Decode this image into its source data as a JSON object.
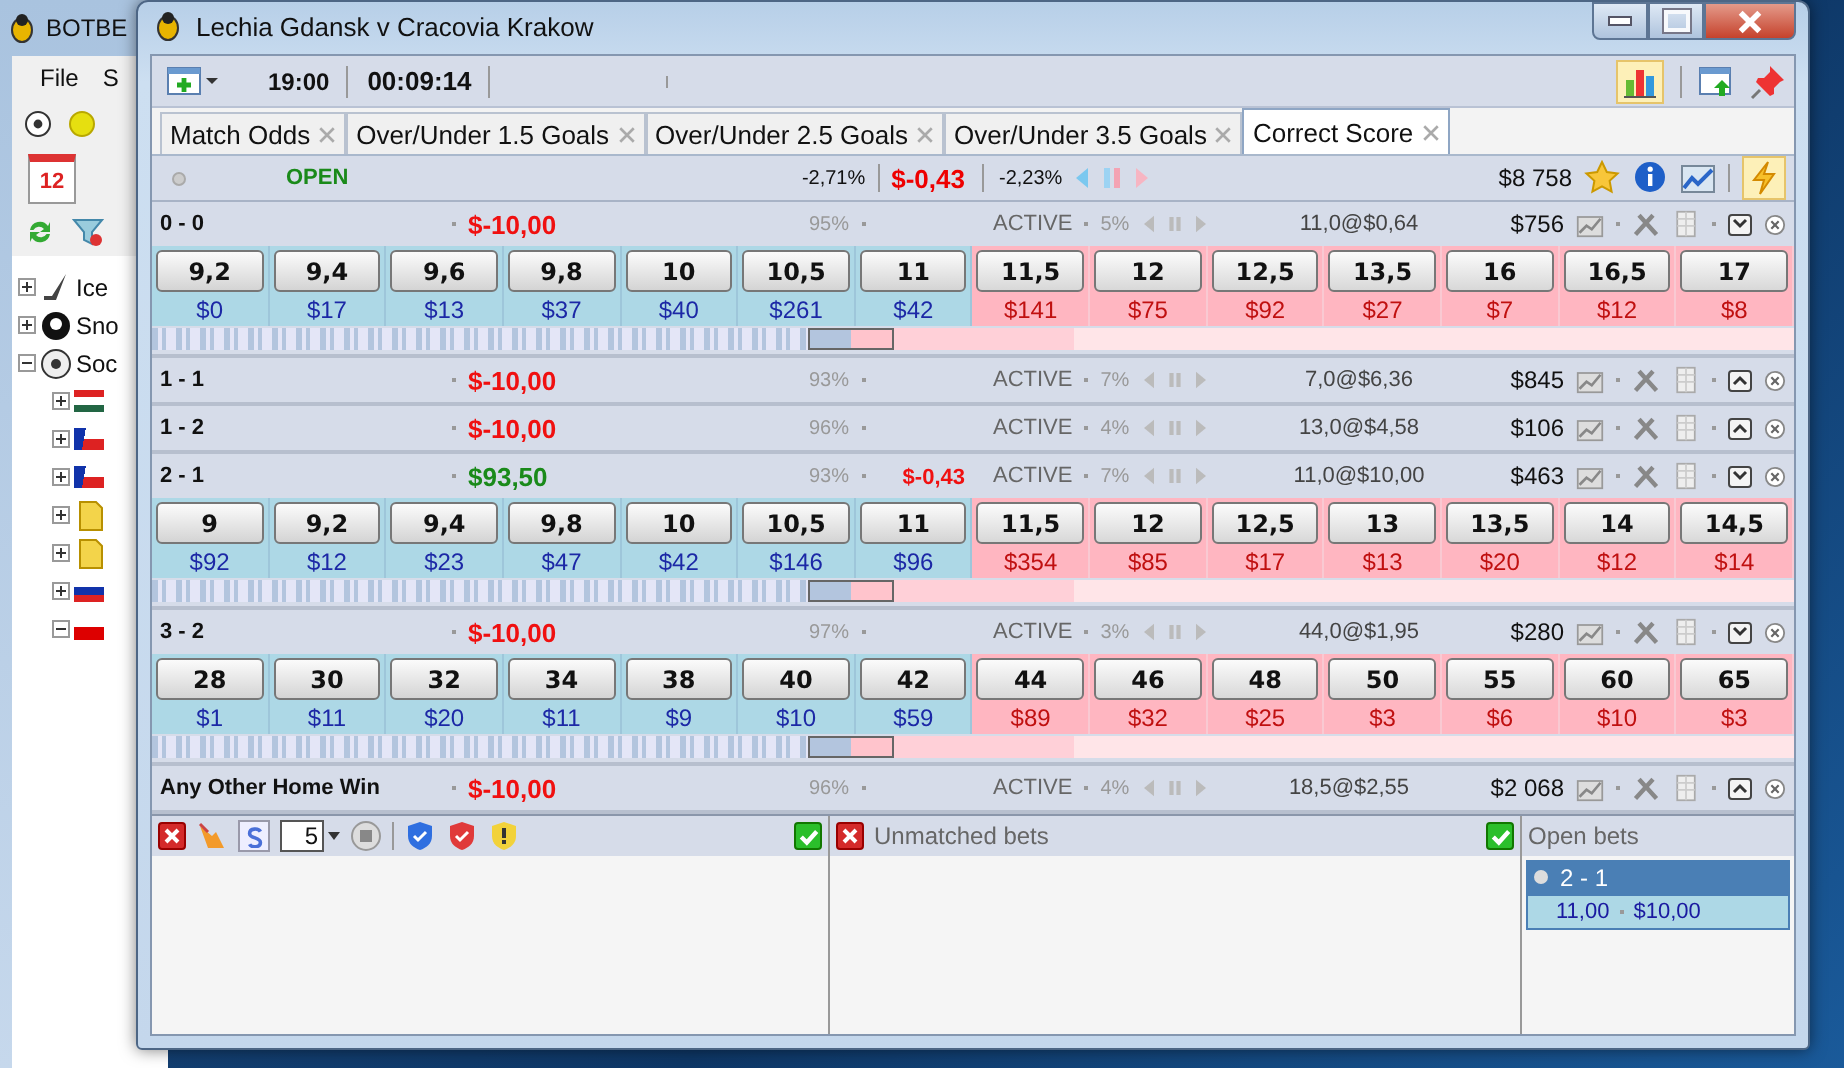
{
  "background_window": {
    "title": "BOTBE",
    "menu": [
      "File",
      "S"
    ],
    "calendar_day": "12",
    "tree": [
      {
        "label": "Ice",
        "kind": "hockey",
        "expanded": false
      },
      {
        "label": "Sno",
        "kind": "snooker",
        "expanded": false
      },
      {
        "label": "Soc",
        "kind": "soccer",
        "expanded": true,
        "children": [
          {
            "kind": "hu",
            "expanded": false
          },
          {
            "kind": "cz",
            "expanded": false
          },
          {
            "kind": "cz",
            "expanded": false
          },
          {
            "kind": "folder",
            "expanded": false
          },
          {
            "kind": "folder",
            "expanded": false
          },
          {
            "kind": "si",
            "expanded": false
          },
          {
            "kind": "pl",
            "expanded": true
          }
        ]
      }
    ]
  },
  "window": {
    "title": "Lechia Gdansk v Cracovia Krakow"
  },
  "toolbar": {
    "start_time": "19:00",
    "elapsed": "00:09:14"
  },
  "tabs": [
    {
      "label": "Match Odds",
      "selected": false
    },
    {
      "label": "Over/Under 1.5 Goals",
      "selected": false
    },
    {
      "label": "Over/Under 2.5 Goals",
      "selected": false
    },
    {
      "label": "Over/Under 3.5 Goals",
      "selected": false
    },
    {
      "label": "Correct Score",
      "selected": true
    }
  ],
  "summary": {
    "status": "OPEN",
    "back_overround": "-2,71%",
    "profit": "$-0,43",
    "lay_overround": "-2,23%",
    "matched_total": "$8 758"
  },
  "selections": [
    {
      "name": "0 - 0",
      "pl": "$-10,00",
      "pl_positive": false,
      "back_pct": "95%",
      "status": "ACTIVE",
      "lay_pct": "5%",
      "last": "11,0@$0,64",
      "matched": "$756",
      "expanded": true,
      "back": [
        {
          "odds": "9,2",
          "amount": "$0"
        },
        {
          "odds": "9,4",
          "amount": "$17"
        },
        {
          "odds": "9,6",
          "amount": "$13"
        },
        {
          "odds": "9,8",
          "amount": "$37"
        },
        {
          "odds": "10",
          "amount": "$40"
        },
        {
          "odds": "10,5",
          "amount": "$261"
        },
        {
          "odds": "11",
          "amount": "$42"
        }
      ],
      "lay": [
        {
          "odds": "11,5",
          "amount": "$141"
        },
        {
          "odds": "12",
          "amount": "$75"
        },
        {
          "odds": "12,5",
          "amount": "$92"
        },
        {
          "odds": "13,5",
          "amount": "$27"
        },
        {
          "odds": "16",
          "amount": "$7"
        },
        {
          "odds": "16,5",
          "amount": "$12"
        },
        {
          "odds": "17",
          "amount": "$8"
        }
      ]
    },
    {
      "name": "1 - 1",
      "pl": "$-10,00",
      "pl_positive": false,
      "back_pct": "93%",
      "status": "ACTIVE",
      "lay_pct": "7%",
      "last": "7,0@$6,36",
      "matched": "$845",
      "expanded": false
    },
    {
      "name": "1 - 2",
      "pl": "$-10,00",
      "pl_positive": false,
      "back_pct": "96%",
      "status": "ACTIVE",
      "lay_pct": "4%",
      "last": "13,0@$4,58",
      "matched": "$106",
      "expanded": false
    },
    {
      "name": "2 - 1",
      "pl": "$93,50",
      "pl_positive": true,
      "back_pct": "93%",
      "hedge": "$-0,43",
      "status": "ACTIVE",
      "lay_pct": "7%",
      "last": "11,0@$10,00",
      "matched": "$463",
      "expanded": true,
      "back": [
        {
          "odds": "9",
          "amount": "$92"
        },
        {
          "odds": "9,2",
          "amount": "$12"
        },
        {
          "odds": "9,4",
          "amount": "$23"
        },
        {
          "odds": "9,8",
          "amount": "$47"
        },
        {
          "odds": "10",
          "amount": "$42"
        },
        {
          "odds": "10,5",
          "amount": "$146"
        },
        {
          "odds": "11",
          "amount": "$96"
        }
      ],
      "lay": [
        {
          "odds": "11,5",
          "amount": "$354"
        },
        {
          "odds": "12",
          "amount": "$85"
        },
        {
          "odds": "12,5",
          "amount": "$17"
        },
        {
          "odds": "13",
          "amount": "$13"
        },
        {
          "odds": "13,5",
          "amount": "$20"
        },
        {
          "odds": "14",
          "amount": "$12"
        },
        {
          "odds": "14,5",
          "amount": "$14"
        }
      ]
    },
    {
      "name": "3 - 2",
      "pl": "$-10,00",
      "pl_positive": false,
      "back_pct": "97%",
      "status": "ACTIVE",
      "lay_pct": "3%",
      "last": "44,0@$1,95",
      "matched": "$280",
      "expanded": true,
      "back": [
        {
          "odds": "28",
          "amount": "$1"
        },
        {
          "odds": "30",
          "amount": "$11"
        },
        {
          "odds": "32",
          "amount": "$20"
        },
        {
          "odds": "34",
          "amount": "$11"
        },
        {
          "odds": "38",
          "amount": "$9"
        },
        {
          "odds": "40",
          "amount": "$10"
        },
        {
          "odds": "42",
          "amount": "$59"
        }
      ],
      "lay": [
        {
          "odds": "44",
          "amount": "$89"
        },
        {
          "odds": "46",
          "amount": "$32"
        },
        {
          "odds": "48",
          "amount": "$25"
        },
        {
          "odds": "50",
          "amount": "$3"
        },
        {
          "odds": "55",
          "amount": "$6"
        },
        {
          "odds": "60",
          "amount": "$10"
        },
        {
          "odds": "65",
          "amount": "$3"
        }
      ]
    },
    {
      "name": "Any Other Home Win",
      "pl": "$-10,00",
      "pl_positive": false,
      "back_pct": "96%",
      "status": "ACTIVE",
      "lay_pct": "4%",
      "last": "18,5@$2,55",
      "matched": "$2 068",
      "expanded": false
    }
  ],
  "bottom": {
    "stake": "5",
    "unmatched_title": "Unmatched bets",
    "open_title": "Open bets",
    "open_bets": [
      {
        "label": "2 - 1",
        "selected": true,
        "children": [
          {
            "odds": "11,00",
            "stake": "$10,00"
          }
        ]
      }
    ]
  }
}
